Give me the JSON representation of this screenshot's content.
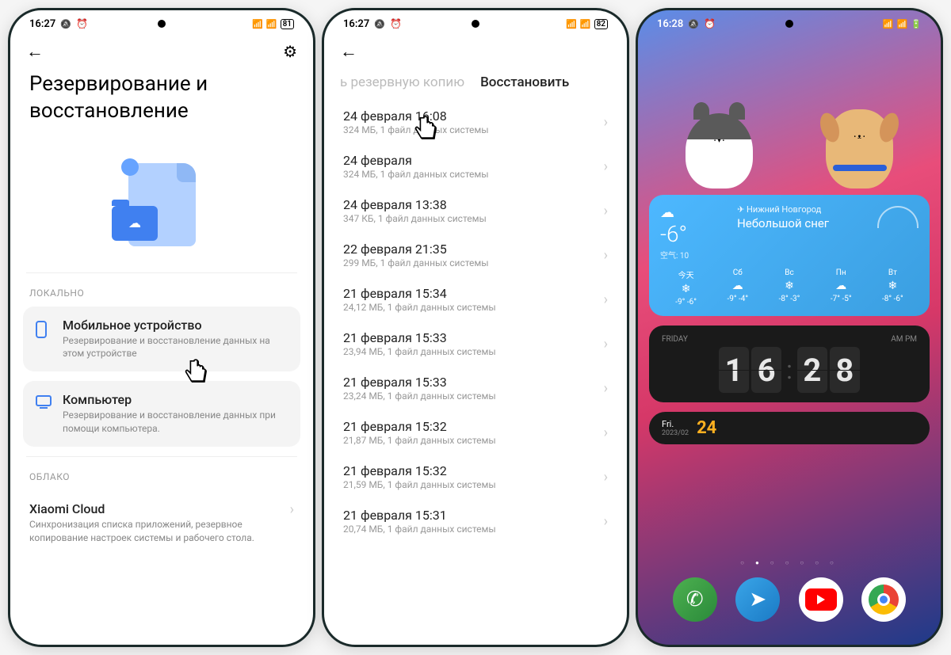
{
  "phone1": {
    "status": {
      "time": "16:27",
      "battery": "81"
    },
    "title": "Резервирование и восстановление",
    "section_local": "ЛОКАЛЬНО",
    "section_cloud": "ОБЛАКО",
    "opt_mobile": {
      "title": "Мобильное устройство",
      "desc": "Резервирование и восстановление данных на этом устройстве"
    },
    "opt_pc": {
      "title": "Компьютер",
      "desc": "Резервирование и восстановление данных при помощи компьютера."
    },
    "cloud": {
      "title": "Xiaomi Cloud",
      "desc": "Синхронизация списка приложений, резервное копирование настроек системы и рабочего стола."
    }
  },
  "phone2": {
    "status": {
      "time": "16:27",
      "battery": "82"
    },
    "tab_inactive": "ь резервную копию",
    "tab_active": "Восстановить",
    "backups": [
      {
        "t": "24 февраля 16:08",
        "d": "324 МБ, 1 файл данных системы"
      },
      {
        "t": "24 февраля",
        "d": "324 МБ, 1 файл данных системы"
      },
      {
        "t": "24 февраля 13:38",
        "d": "347 КБ, 1 файл данных системы"
      },
      {
        "t": "22 февраля 21:35",
        "d": "299 МБ, 1 файл данных системы"
      },
      {
        "t": "21 февраля 15:34",
        "d": "24,12 МБ, 1 файл данных системы"
      },
      {
        "t": "21 февраля 15:33",
        "d": "23,94 МБ, 1 файл данных системы"
      },
      {
        "t": "21 февраля 15:33",
        "d": "23,24 МБ, 1 файл данных системы"
      },
      {
        "t": "21 февраля 15:32",
        "d": "21,87 МБ, 1 файл данных системы"
      },
      {
        "t": "21 февраля 15:32",
        "d": "21,59 МБ, 1 файл данных системы"
      },
      {
        "t": "21 февраля 15:31",
        "d": "20,74 МБ, 1 файл данных системы"
      }
    ]
  },
  "phone3": {
    "status": {
      "time": "16:28"
    },
    "weather": {
      "location": "Нижний Новгород",
      "condition": "Небольшой снег",
      "temp": "-6°",
      "aqi": "空气: 10",
      "today_label": "今天",
      "days": [
        {
          "n": "今天",
          "i": "❄",
          "lo": "-9°",
          "hi": "-6°"
        },
        {
          "n": "Сб",
          "i": "☁",
          "lo": "-9°",
          "hi": "-4°"
        },
        {
          "n": "Вс",
          "i": "❄",
          "lo": "-8°",
          "hi": "-3°"
        },
        {
          "n": "Пн",
          "i": "☁",
          "lo": "-7°",
          "hi": "-5°"
        },
        {
          "n": "Вт",
          "i": "❄",
          "lo": "-8°",
          "hi": "-6°"
        }
      ]
    },
    "clock": {
      "day": "FRIDAY",
      "ampm": "AM PM",
      "h1": "1",
      "h2": "6",
      "m1": "2",
      "m2": "8"
    },
    "date": {
      "day": "Fri.",
      "sub": "2023/02",
      "num": "24"
    }
  }
}
